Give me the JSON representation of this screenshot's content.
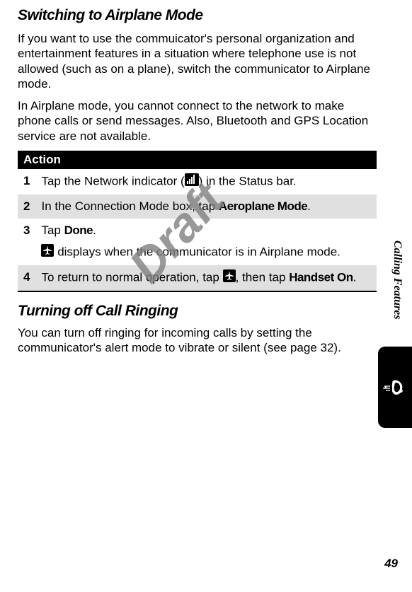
{
  "watermark": "Draft",
  "heading_airplane": "Switching to Airplane Mode",
  "para1": "If you want to use the commuicator's personal organization and entertainment features in a situation where telephone use is not allowed (such as on a plane), switch the communicator to Airplane mode.",
  "para2": "In Airplane mode, you cannot connect to the network to make phone calls or send messages. Also, Bluetooth and GPS Location service are not available.",
  "action_header": "Action",
  "steps": {
    "s1": {
      "num": "1",
      "pre": "Tap the Network indicator (",
      "post": ") in the Status bar."
    },
    "s2": {
      "num": "2",
      "pre": "In the Connection Mode box, tap ",
      "bold": "Aeroplane Mode",
      "post": "."
    },
    "s3": {
      "num": "3",
      "pre": "Tap ",
      "bold": "Done",
      "post": ".",
      "extra_pre": "",
      "extra_post": " displays when the communicator is in Airplane mode."
    },
    "s4": {
      "num": "4",
      "pre": "To return to normal operation, tap ",
      "mid": ", then tap ",
      "bold": "Handset On",
      "post": "."
    }
  },
  "heading_ringing": "Turning off Call Ringing",
  "para3": "You can turn off ringing for incoming calls by setting the communicator's alert mode to vibrate or silent (see page 32).",
  "side_label": "Calling Features",
  "page_num": "49"
}
